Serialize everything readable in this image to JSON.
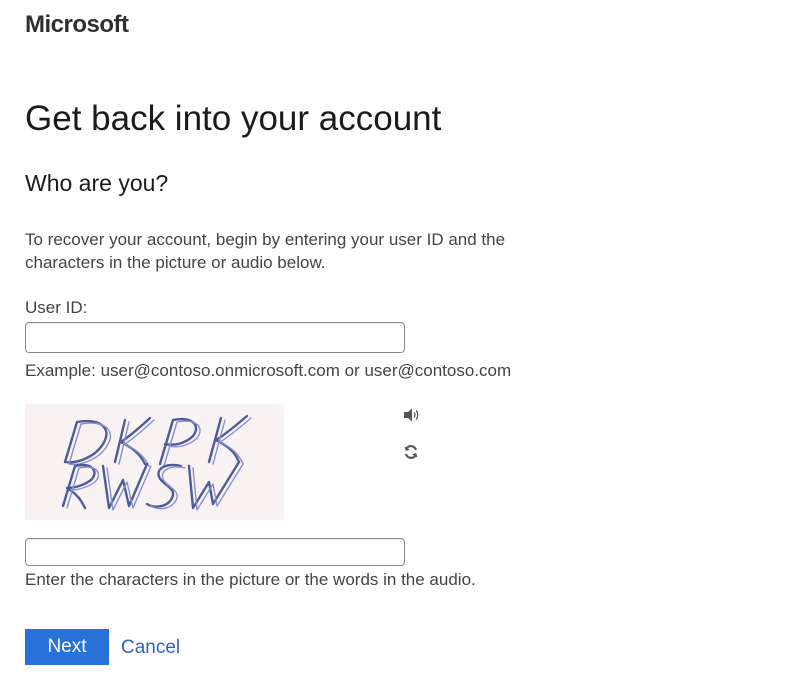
{
  "brand": {
    "logo_text": "Microsoft"
  },
  "page": {
    "title": "Get back into your account",
    "subtitle": "Who are you?",
    "instructions_line1": "To recover your account, begin by entering your user ID and the",
    "instructions_line2": "characters in the picture or audio below."
  },
  "user_id": {
    "label": "User ID:",
    "value": "",
    "placeholder": "",
    "example": "Example: user@contoso.onmicrosoft.com or user@contoso.com"
  },
  "captcha": {
    "image_text": "DKPK RWSW",
    "audio_icon": "speaker-icon",
    "refresh_icon": "refresh-icon",
    "input_value": "",
    "hint": "Enter the characters in the picture or the words in the audio."
  },
  "actions": {
    "next_label": "Next",
    "cancel_label": "Cancel"
  },
  "colors": {
    "primary_button": "#2672d9",
    "link": "#2a66c2",
    "captcha_bg": "#f9f2f3"
  }
}
